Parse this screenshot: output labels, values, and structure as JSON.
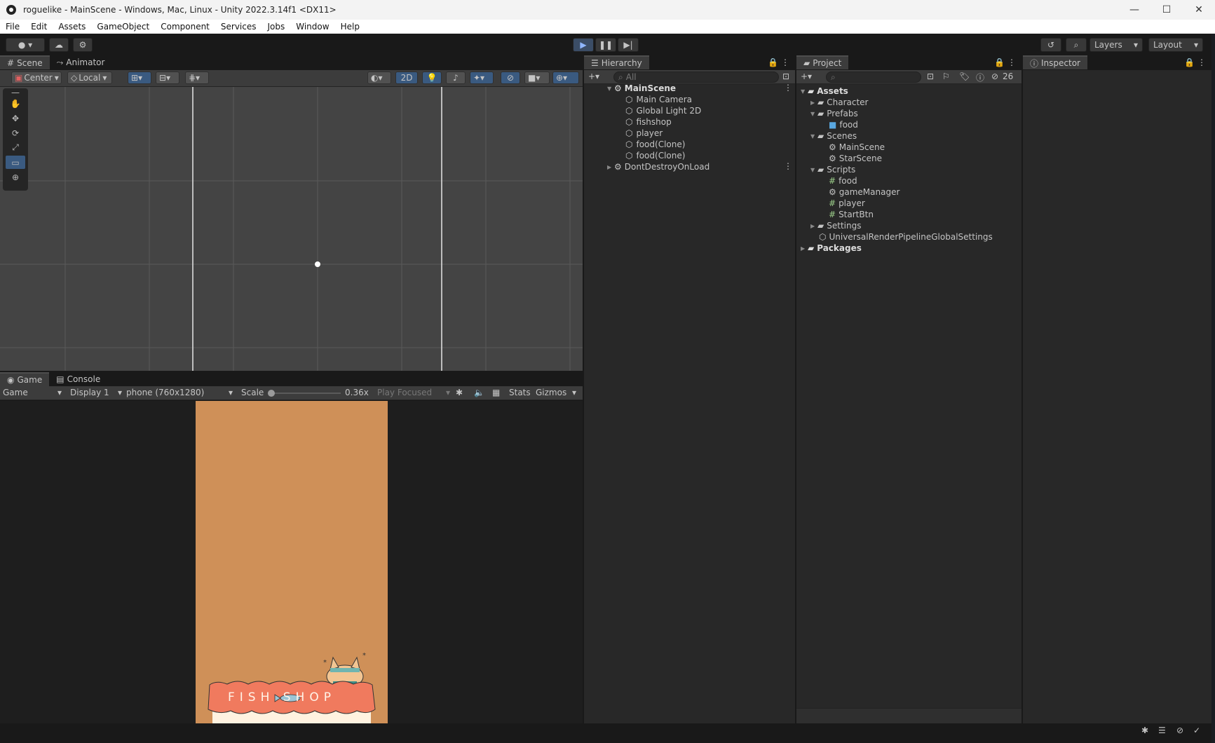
{
  "window": {
    "title": "roguelike - MainScene - Windows, Mac, Linux - Unity 2022.3.14f1 <DX11>",
    "controls": [
      "—",
      "☐",
      "✕"
    ]
  },
  "menu": [
    "File",
    "Edit",
    "Assets",
    "GameObject",
    "Component",
    "Services",
    "Jobs",
    "Window",
    "Help"
  ],
  "toolbar": {
    "layers_label": "Layers",
    "layout_label": "Layout"
  },
  "scene": {
    "tabs": [
      "Scene",
      "Animator"
    ],
    "pivot_label": "Center",
    "space_label": "Local",
    "mode_2d_label": "2D"
  },
  "game": {
    "tabs": [
      "Game",
      "Console"
    ],
    "mode_label": "Game",
    "display_label": "Display 1",
    "resolution_label": "phone (760x1280)",
    "scale_label": "Scale",
    "scale_value": "0.36x",
    "play_focus_label": "Play Focused",
    "stats_label": "Stats",
    "gizmos_label": "Gizmos",
    "shop_sign_text": "FISH SHOP",
    "colors": {
      "background": "#CF9058",
      "sign": "#F07A5E"
    }
  },
  "hierarchy": {
    "tab_label": "Hierarchy",
    "search_placeholder": "All",
    "scene_name": "MainScene",
    "children": [
      "Main Camera",
      "Global Light 2D",
      "fishshop",
      "player",
      "food(Clone)",
      "food(Clone)"
    ],
    "ddol_label": "DontDestroyOnLoad"
  },
  "project": {
    "tab_label": "Project",
    "hidden_count": "26",
    "tree": {
      "assets": "Assets",
      "character": "Character",
      "prefabs": "Prefabs",
      "prefab_food": "food",
      "scenes": "Scenes",
      "scene_main": "MainScene",
      "scene_star": "StarScene",
      "scripts": "Scripts",
      "script_food": "food",
      "script_gamemanager": "gameManager",
      "script_player": "player",
      "script_startbtn": "StartBtn",
      "settings": "Settings",
      "urp": "UniversalRenderPipelineGlobalSettings",
      "packages": "Packages"
    }
  },
  "inspector": {
    "tab_label": "Inspector"
  }
}
